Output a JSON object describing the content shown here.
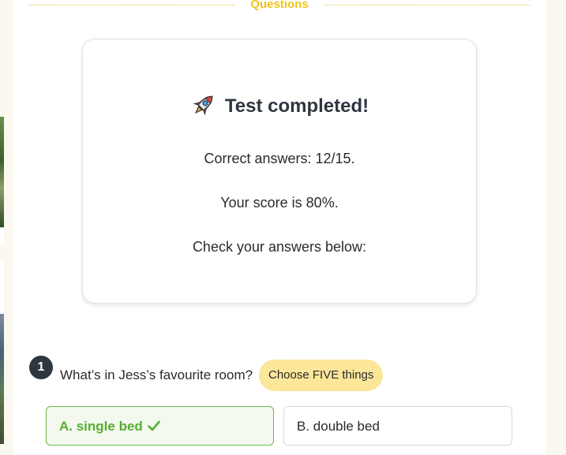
{
  "section": {
    "title": "Questions"
  },
  "result": {
    "icon": "rocket-icon",
    "title": "Test completed!",
    "correct_answers": "Correct answers: 12/15.",
    "score": "Your score is 80%.",
    "check_prompt": "Check your answers below:"
  },
  "question": {
    "number": "1",
    "text": "What’s in Jess’s favourite room?",
    "tag": "Choose FIVE things",
    "options": [
      {
        "label": "A. single bed",
        "state": "correct",
        "icon": "checkmark-icon"
      },
      {
        "label": "B. double bed",
        "state": "unselected"
      }
    ]
  },
  "colors": {
    "accent_yellow": "#f0c419",
    "tag_background": "#fbe69a",
    "correct_green": "#58ad34",
    "dark_badge": "#2f3640"
  }
}
